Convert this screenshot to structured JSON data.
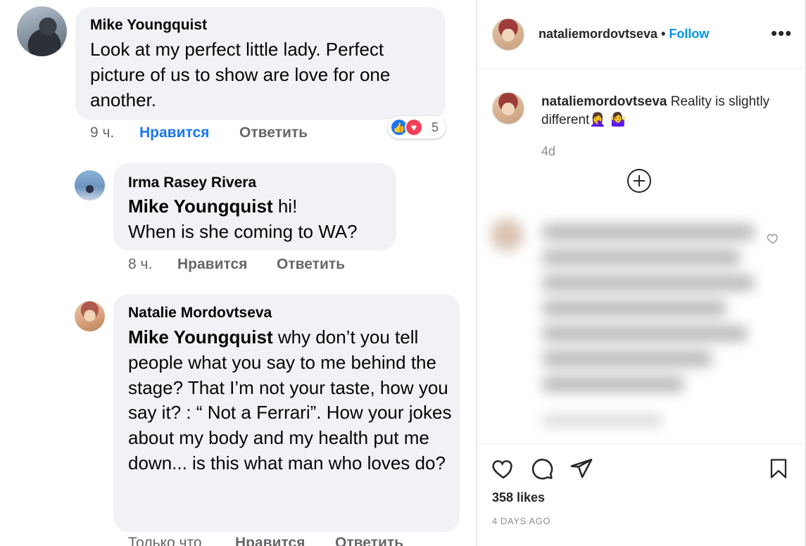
{
  "facebook": {
    "comments": [
      {
        "author": "Mike Youngquist",
        "text": "Look at my perfect little lady. Perfect picture of us to show are love for one another.",
        "time": "9 ч.",
        "like": "Нравится",
        "reply": "Ответить",
        "reaction_count": "5",
        "reaction_icons": [
          "like-icon",
          "love-icon"
        ]
      },
      {
        "author": "Irma Rasey Rivera",
        "mention": "Mike Youngquist",
        "text_after_mention": " hi!",
        "text_line2": "When is she coming to WA?",
        "time": "8 ч.",
        "like": "Нравится",
        "reply": "Ответить"
      },
      {
        "author": "Natalie Mordovtseva",
        "mention": "Mike Youngquist",
        "text": " why don’t you tell people what you say to me behind the stage? That I’m not your taste, how you say it? : “ Not a Ferrari”. How your jokes about my body and my health put me down... is this what man who loves do?",
        "time": "Только что",
        "like": "Нравится",
        "reply": "Ответить"
      }
    ]
  },
  "instagram": {
    "username": "nataliemordovtseva",
    "separator": "•",
    "follow_label": "Follow",
    "more_label": "•••",
    "caption_user": "nataliemordovtseva",
    "caption_text": " Reality is slightly different🤦‍♀️ 🤷‍♀️",
    "caption_age": "4d",
    "likes": "358 likes",
    "post_age": "4 DAYS AGO"
  },
  "colors": {
    "facebook_bubble": "#f0f2f5",
    "facebook_like_blue": "#1877f2",
    "facebook_meta_gray": "#65676b",
    "instagram_follow_blue": "#0095f6",
    "instagram_text": "#262626",
    "instagram_meta_gray": "#8e8e8e"
  }
}
